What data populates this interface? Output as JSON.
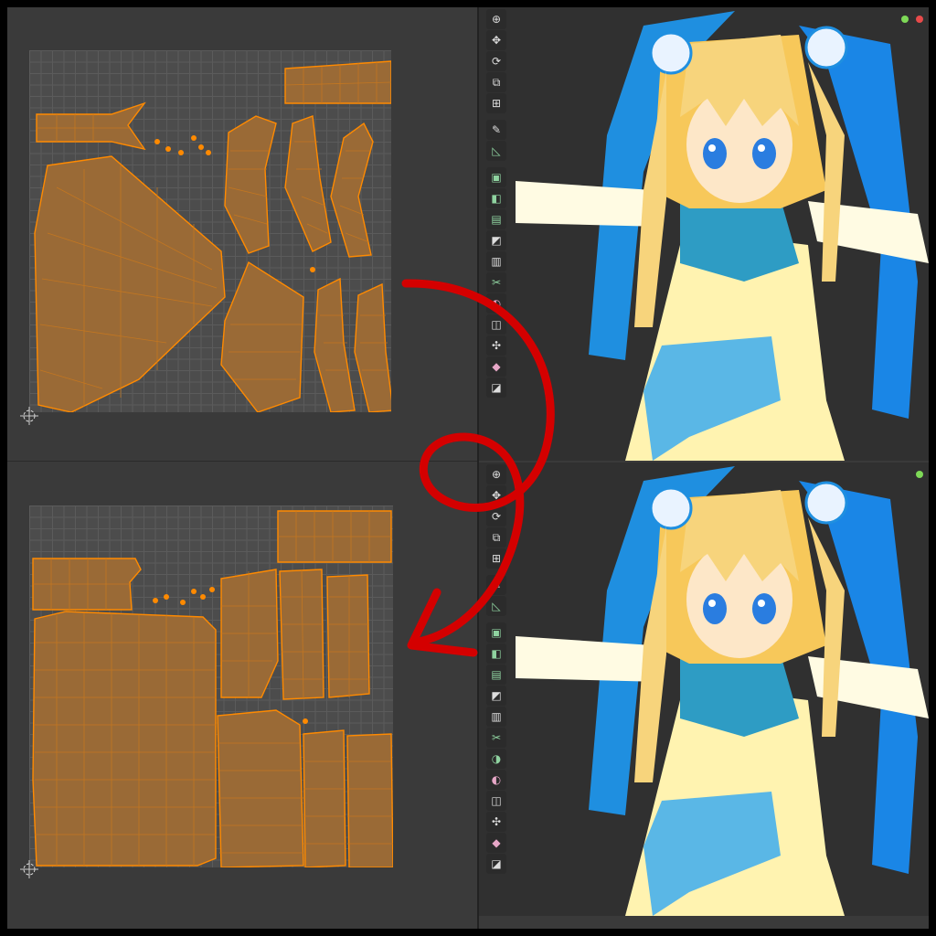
{
  "uv_editor": {
    "before_label": "uv-layout-before",
    "after_label": "uv-layout-after"
  },
  "toolbar_top": {
    "tools": [
      "cursor-icon",
      "move-icon",
      "rotate-icon",
      "scale-icon",
      "transform-icon",
      "annotate-icon",
      "measure-icon",
      "add-cube-icon",
      "extrude-icon",
      "inset-icon",
      "bevel-icon",
      "loop-cut-icon",
      "knife-icon",
      "poly-build-icon",
      "spin-icon",
      "smooth-icon",
      "edge-slide-icon",
      "shrink-fatten-icon",
      "shear-icon",
      "rip-icon"
    ]
  },
  "toolbar_bottom": {
    "tools": [
      "cursor-icon",
      "move-icon",
      "rotate-icon",
      "scale-icon",
      "transform-icon",
      "annotate-icon",
      "measure-icon",
      "add-cube-icon",
      "extrude-icon",
      "inset-icon",
      "bevel-icon",
      "loop-cut-icon",
      "knife-icon",
      "poly-build-icon",
      "spin-icon",
      "smooth-icon",
      "edge-slide-icon",
      "shrink-fatten-icon",
      "shear-icon",
      "rip-icon"
    ]
  },
  "colors": {
    "uv_face": "#9a6a36",
    "uv_edge": "#ff8a00",
    "annotation_arrow": "#d40000",
    "hair": "#f7d47c",
    "ribbon": "#1f8fe0",
    "dress": "#fff3b0"
  }
}
